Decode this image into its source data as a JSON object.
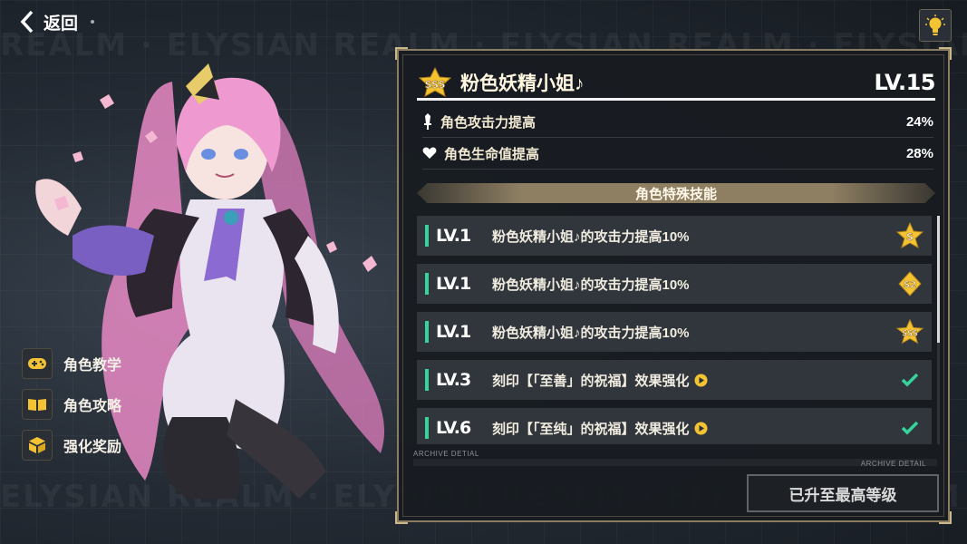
{
  "top_bar": {
    "back_label": "返回"
  },
  "watermark": {
    "top": "REALM · ELYSIAN REALM · ELYSIAN REALM · ELYSIAN REALM",
    "bottom": "ELYSIAN REALM · ELYSIAN REALM · ELYSIAN REALM · ELYSIAN REALM"
  },
  "side_menu": {
    "items": [
      {
        "label": "角色教学",
        "icon": "gamepad-icon"
      },
      {
        "label": "角色攻略",
        "icon": "book-icon"
      },
      {
        "label": "强化奖励",
        "icon": "cube-icon"
      }
    ]
  },
  "panel": {
    "rank": "SSS",
    "name": "粉色妖精小姐♪",
    "level": "LV.15",
    "stats": [
      {
        "label": "角色攻击力提高",
        "value": "24%",
        "icon": "sword-icon"
      },
      {
        "label": "角色生命值提高",
        "value": "28%",
        "icon": "heart-icon"
      }
    ],
    "skills_title": "角色特殊技能",
    "skills": [
      {
        "level": "LV.1",
        "desc": "粉色妖精小姐♪的攻击力提高10%",
        "status": "rank-s-badge-icon",
        "status_text": "S"
      },
      {
        "level": "LV.1",
        "desc": "粉色妖精小姐♪的攻击力提高10%",
        "status": "rank-s2-badge-icon",
        "status_text": "S2"
      },
      {
        "level": "LV.1",
        "desc": "粉色妖精小姐♪的攻击力提高10%",
        "status": "rank-sss-badge-icon",
        "status_text": "SSS"
      },
      {
        "level": "LV.3",
        "desc": "刻印【「至善」的祝福】效果强化",
        "status": "checkmark-icon",
        "status_text": ""
      },
      {
        "level": "LV.6",
        "desc": "刻印【「至纯」的祝福】效果强化",
        "status": "checkmark-icon",
        "status_text": ""
      }
    ],
    "archive_label": "ARCHIVE DETIAL",
    "archive_label_right": "ARCHIVE DETAIL",
    "max_button": "已升至最高等级"
  },
  "colors": {
    "accent_green": "#36d49a",
    "gold": "#f3c334",
    "frame": "#8a7d62"
  },
  "scroll": {
    "position_fraction": 0.0,
    "visible_fraction": 0.56
  }
}
